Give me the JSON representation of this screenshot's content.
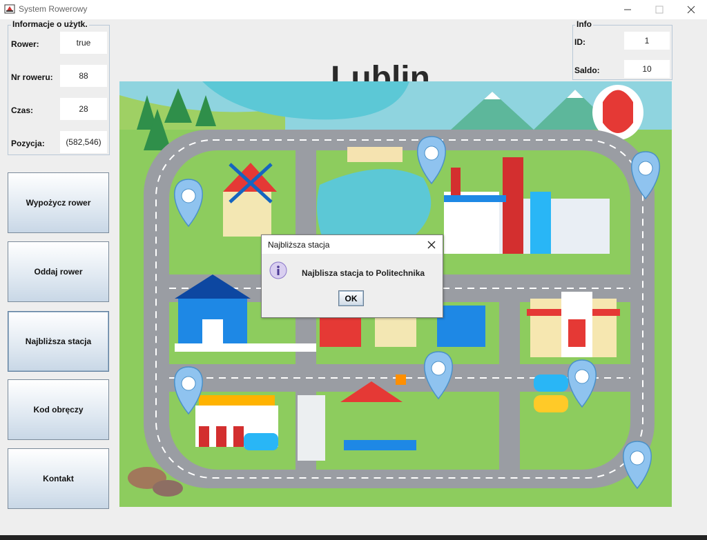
{
  "window": {
    "title": "System Rowerowy"
  },
  "user_panel": {
    "title": "Informacje o użytk.",
    "fields": [
      {
        "label": "Rower:",
        "value": "true"
      },
      {
        "label": "Nr roweru:",
        "value": "88"
      },
      {
        "label": "Czas:",
        "value": "28"
      },
      {
        "label": "Pozycja:",
        "value": "(582,546)"
      }
    ]
  },
  "info_panel": {
    "title": "Info",
    "fields": [
      {
        "label": "ID:",
        "value": "1"
      },
      {
        "label": "Saldo:",
        "value": "10"
      }
    ]
  },
  "city_name": "Lublin",
  "menu": {
    "buttons": [
      "Wypożycz rower",
      "Oddaj rower",
      "Najbliższa stacja",
      "Kod obręczy",
      "Kontakt"
    ]
  },
  "map": {
    "station_count": 8
  },
  "dialog": {
    "title": "Najbliższa stacja",
    "message": "Najblisza stacja to Politechnika",
    "ok_label": "OK",
    "icon": "info-icon"
  },
  "colors": {
    "pin": "#8fc3ef",
    "grass": "#8dcc5e",
    "road": "#9a9da3",
    "water": "#5fc8d8",
    "accent_button": "#dfe8f1"
  }
}
